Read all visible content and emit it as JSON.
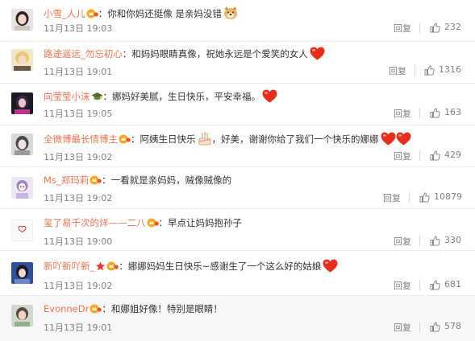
{
  "reply_label": "回复",
  "colors": {
    "username": "#eb7350",
    "meta": "#808080",
    "text": "#333333"
  },
  "comments": [
    {
      "user": "小雪_人儿",
      "text": "你和你妈还挺像 是亲妈没错",
      "time": "11月13日 19:03",
      "likes": "232",
      "badges": [
        "member-crown-icon"
      ],
      "emoji": [
        "dog-emoji"
      ]
    },
    {
      "user": "路途遥远_勿忘初心",
      "text": "和妈妈眼睛真像，祝她永远是个爱笑的女人",
      "time": "11月13日 19:01",
      "likes": "1316",
      "badges": [],
      "emoji": [
        "heart-emoji"
      ]
    },
    {
      "user": "向莹莹小沫",
      "text": "娜妈好美腻，生日快乐，平安幸福。",
      "time": "11月13日 19:05",
      "likes": "163",
      "badges": [
        "graduation-cap-icon"
      ],
      "emoji": [
        "heart-emoji"
      ]
    },
    {
      "user": "全微博最长情博主",
      "text": "阿姨生日快乐",
      "text2": "，好美，谢谢你给了我们一个快乐的娜娜",
      "time": "11月13日 19:02",
      "likes": "429",
      "badges": [
        "member-crown-icon"
      ],
      "emoji": [
        "cake-emoji"
      ],
      "emoji2": [
        "heart-emoji",
        "heart-emoji"
      ]
    },
    {
      "user": "Ms_郑玛莉",
      "text": "一看就是亲妈妈，贼像贼像的",
      "time": "11月13日 19:02",
      "likes": "10879",
      "badges": [
        "member-crown-icon"
      ],
      "emoji": []
    },
    {
      "user": "玺了易千次的烊——二八",
      "text": "早点让妈妈抱孙子",
      "time": "11月13日 19:00",
      "likes": "330",
      "badges": [
        "member-crown-icon"
      ],
      "emoji": []
    },
    {
      "user": "新吖新吖新_",
      "text": "娜娜妈妈生日快乐~感谢生了一个这么好的姑娘",
      "time": "11月13日 19:02",
      "likes": "681",
      "badges": [
        "star-icon",
        "member-crown-icon"
      ],
      "emoji": [
        "heart-emoji"
      ]
    },
    {
      "user": "EvonneDr",
      "text": "和娜姐好像！特别是眼睛！",
      "time": "11月13日 19:01",
      "likes": "578",
      "badges": [
        "member-crown-icon"
      ],
      "emoji": []
    }
  ]
}
